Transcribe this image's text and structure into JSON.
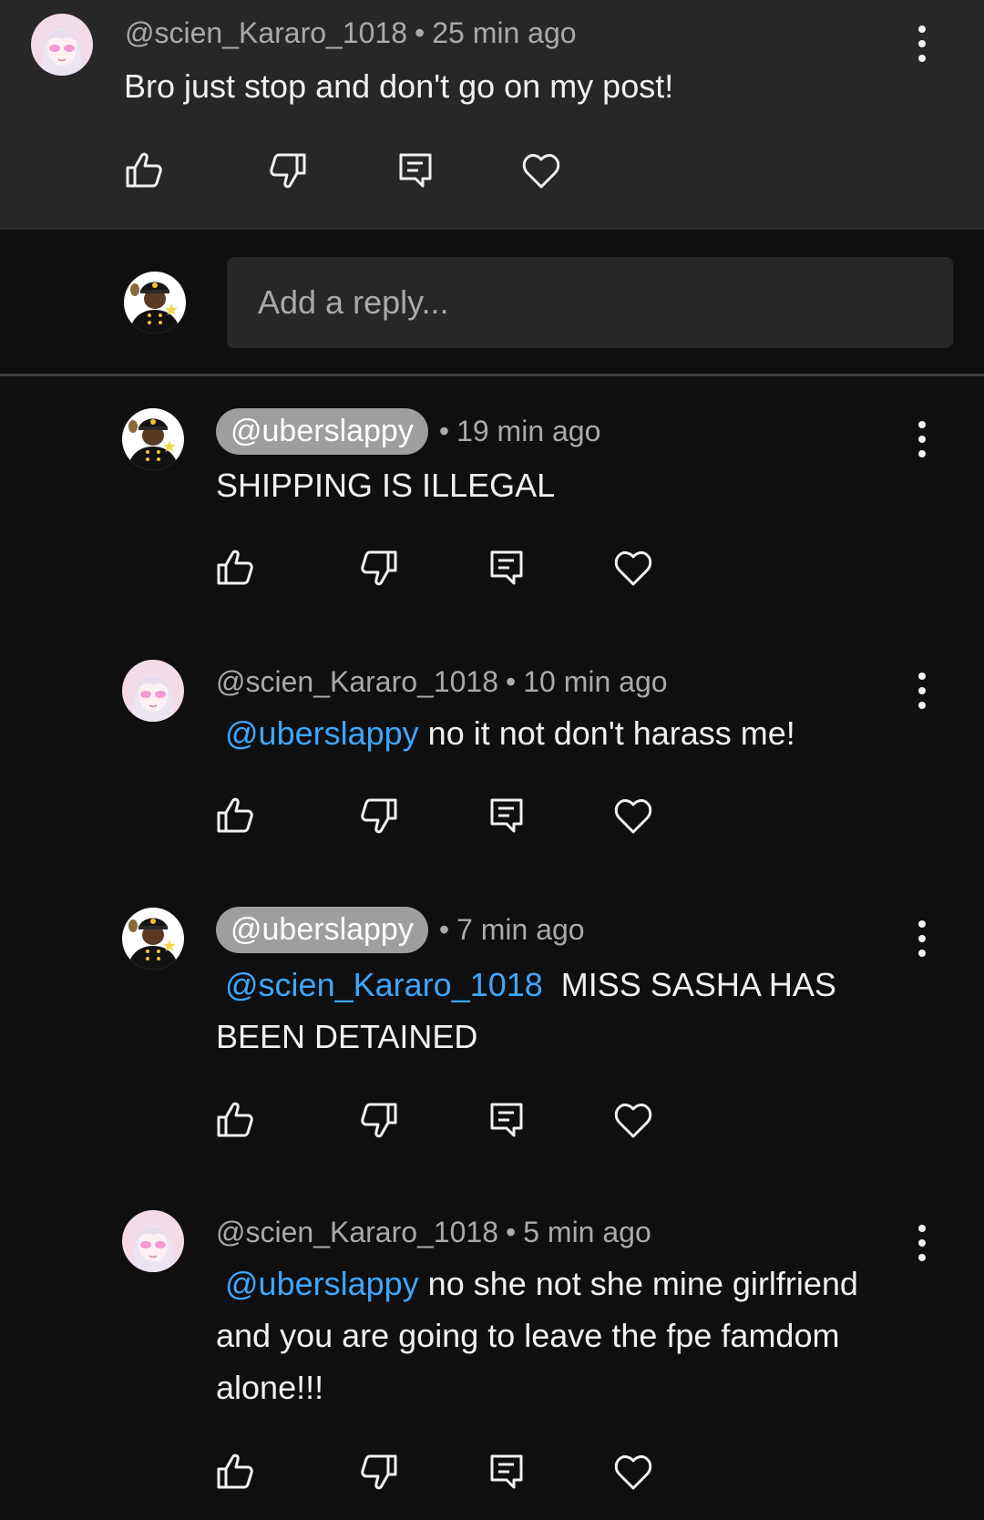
{
  "top_comment": {
    "author": "@scien_Kararo_1018",
    "time": "25 min ago",
    "text": "Bro just stop and don't go on my post!"
  },
  "reply_box": {
    "placeholder": "Add a reply..."
  },
  "replies": [
    {
      "author": "@uberslappy",
      "author_highlighted": true,
      "time": "19 min ago",
      "mention": "",
      "text": "SHIPPING IS ILLEGAL"
    },
    {
      "author": "@scien_Kararo_1018",
      "author_highlighted": false,
      "time": "10 min ago",
      "mention": "@uberslappy",
      "text": "no it not don't harass me!"
    },
    {
      "author": "@uberslappy",
      "author_highlighted": true,
      "time": "7 min ago",
      "mention": "@scien_Kararo_1018",
      "text": "MISS SASHA HAS BEEN DETAINED"
    },
    {
      "author": "@scien_Kararo_1018",
      "author_highlighted": false,
      "time": "5 min ago",
      "mention": "@uberslappy",
      "text": "no she not she mine girlfriend and you are going to leave the fpe famdom alone!!!"
    }
  ],
  "separator": "•",
  "icons": {
    "like": "thumbs-up-icon",
    "dislike": "thumbs-down-icon",
    "reply": "reply-icon",
    "heart": "heart-icon",
    "menu": "more-vert-icon"
  },
  "colors": {
    "background": "#0f0f0f",
    "top_background": "#272727",
    "mention": "#3ea6ff",
    "chip": "#9e9e9e",
    "meta": "#aaaaaa"
  }
}
